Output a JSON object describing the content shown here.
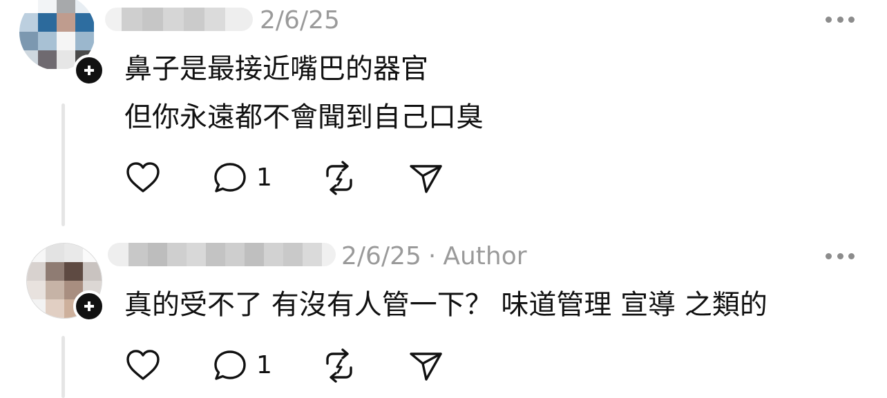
{
  "posts": [
    {
      "date": "2/6/25",
      "author_tag": "",
      "lines": [
        "鼻子是最接近嘴巴的器官",
        "但你永遠都不會聞到自己口臭"
      ],
      "reply_count": "1",
      "icons": {
        "like": "heart-icon",
        "reply": "comment-bubble-icon",
        "repost": "repost-icon",
        "share": "send-icon",
        "more": "more-icon"
      }
    },
    {
      "date": "2/6/25",
      "separator": "·",
      "author_tag": "Author",
      "lines": [
        "真的受不了 有沒有人管一下？ 味道管理 宣導 之類的"
      ],
      "reply_count": "1",
      "icons": {
        "like": "heart-icon",
        "reply": "comment-bubble-icon",
        "repost": "repost-icon",
        "share": "send-icon",
        "more": "more-icon"
      }
    }
  ],
  "colors": {
    "text": "#111111",
    "meta": "#9a9a9a",
    "thread_line": "#e5e5e5",
    "badge": "#111111"
  }
}
